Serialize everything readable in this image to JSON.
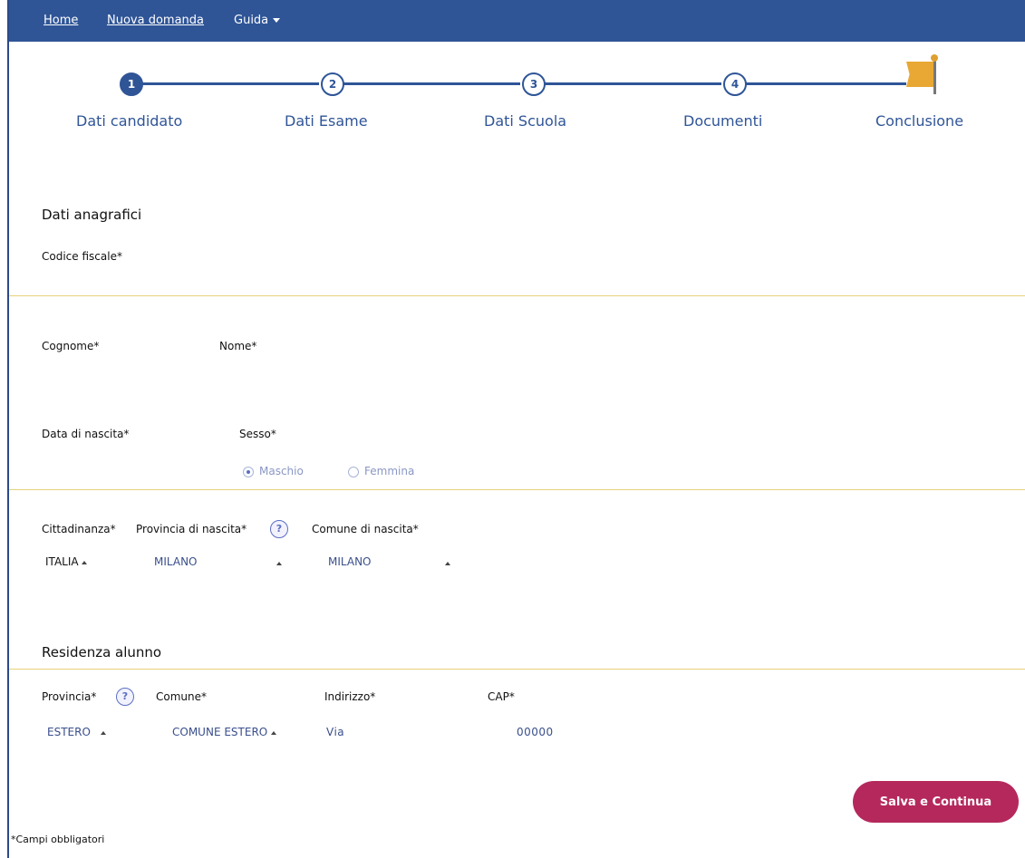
{
  "nav": {
    "home": "Home",
    "new_request": "Nuova domanda",
    "guide": "Guida"
  },
  "steps": [
    {
      "number": "1",
      "label": "Dati candidato",
      "active": true
    },
    {
      "number": "2",
      "label": "Dati Esame",
      "active": false
    },
    {
      "number": "3",
      "label": "Dati Scuola",
      "active": false
    },
    {
      "number": "4",
      "label": "Documenti",
      "active": false
    },
    {
      "label": "Conclusione",
      "icon": "flag-icon"
    }
  ],
  "personal": {
    "title": "Dati anagrafici",
    "fiscal_code_label": "Codice fiscale*",
    "surname_label": "Cognome*",
    "name_label": "Nome*",
    "birth_date_label": "Data di nascita*",
    "sex_label": "Sesso*",
    "sex_options": [
      "Maschio",
      "Femmina"
    ],
    "sex_selected": "Maschio",
    "citizenship_label": "Cittadinanza*",
    "citizenship_value": "ITALIA",
    "birth_province_label": "Provincia di nascita*",
    "birth_province_value": "MILANO",
    "birth_town_label": "Comune di nascita*",
    "birth_town_value": "MILANO",
    "help_glyph": "?"
  },
  "residence": {
    "title": "Residenza alunno",
    "province_label": "Provincia*",
    "province_value": "ESTERO",
    "town_label": "Comune*",
    "town_value": "COMUNE ESTERO",
    "address_label": "Indirizzo*",
    "address_value": "Via",
    "cap_label": "CAP*",
    "cap_value": "00000",
    "help_glyph": "?"
  },
  "actions": {
    "save_continue": "Salva e Continua"
  },
  "footnote": "*Campi obbligatori",
  "colors": {
    "nav_bg": "#2f5597",
    "primary": "#2f5597",
    "button": "#b5285c",
    "accent_line": "#e7d27a"
  }
}
